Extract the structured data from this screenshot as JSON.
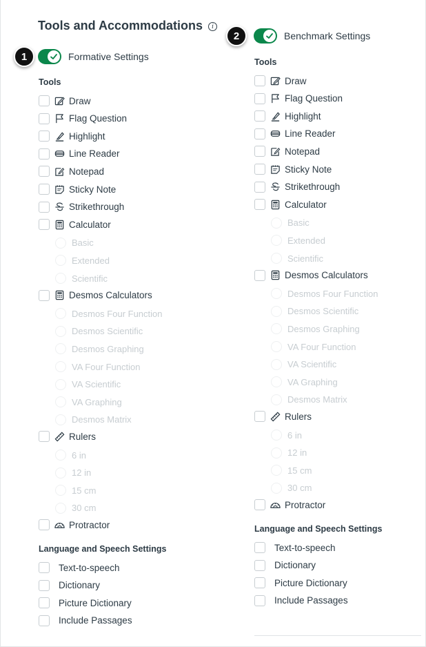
{
  "page_title": "Tools and Accommodations",
  "info_icon": "i",
  "formative": {
    "badge": "1",
    "toggle_label": "Formative Settings",
    "tools_heading": "Tools",
    "tools": [
      {
        "label": "Draw",
        "icon": "draw-icon"
      },
      {
        "label": "Flag Question",
        "icon": "flag-icon"
      },
      {
        "label": "Highlight",
        "icon": "highlight-icon"
      },
      {
        "label": "Line Reader",
        "icon": "line-reader-icon"
      },
      {
        "label": "Notepad",
        "icon": "notepad-icon"
      },
      {
        "label": "Sticky Note",
        "icon": "sticky-note-icon"
      },
      {
        "label": "Strikethrough",
        "icon": "strikethrough-icon"
      },
      {
        "label": "Calculator",
        "icon": "calculator-icon"
      }
    ],
    "calculator_options": [
      "Basic",
      "Extended",
      "Scientific"
    ],
    "desmos": {
      "label": "Desmos Calculators",
      "icon": "calculator-icon"
    },
    "desmos_options": [
      "Desmos Four Function",
      "Desmos Scientific",
      "Desmos Graphing",
      "VA Four Function",
      "VA Scientific",
      "VA Graphing",
      "Desmos Matrix"
    ],
    "rulers": {
      "label": "Rulers",
      "icon": "ruler-icon"
    },
    "ruler_options": [
      "6 in",
      "12 in",
      "15 cm",
      "30 cm"
    ],
    "protractor": {
      "label": "Protractor",
      "icon": "protractor-icon"
    },
    "language_heading": "Language and Speech Settings",
    "language_items": [
      "Text-to-speech",
      "Dictionary",
      "Picture Dictionary",
      "Include Passages"
    ]
  },
  "benchmark": {
    "badge": "2",
    "toggle_label": "Benchmark Settings",
    "tools_heading": "Tools",
    "tools": [
      {
        "label": "Draw",
        "icon": "draw-icon"
      },
      {
        "label": "Flag Question",
        "icon": "flag-icon"
      },
      {
        "label": "Highlight",
        "icon": "highlight-icon"
      },
      {
        "label": "Line Reader",
        "icon": "line-reader-icon"
      },
      {
        "label": "Notepad",
        "icon": "notepad-icon"
      },
      {
        "label": "Sticky Note",
        "icon": "sticky-note-icon"
      },
      {
        "label": "Strikethrough",
        "icon": "strikethrough-icon"
      },
      {
        "label": "Calculator",
        "icon": "calculator-icon"
      }
    ],
    "calculator_options": [
      "Basic",
      "Extended",
      "Scientific"
    ],
    "desmos": {
      "label": "Desmos Calculators",
      "icon": "calculator-icon"
    },
    "desmos_options": [
      "Desmos Four Function",
      "Desmos Scientific",
      "Desmos Graphing",
      "VA Four Function",
      "VA Scientific",
      "VA Graphing",
      "Desmos Matrix"
    ],
    "rulers": {
      "label": "Rulers",
      "icon": "ruler-icon"
    },
    "ruler_options": [
      "6 in",
      "12 in",
      "15 cm",
      "30 cm"
    ],
    "protractor": {
      "label": "Protractor",
      "icon": "protractor-icon"
    },
    "language_heading": "Language and Speech Settings",
    "language_items": [
      "Text-to-speech",
      "Dictionary",
      "Picture Dictionary",
      "Include Passages"
    ]
  },
  "colors": {
    "toggle_on": "#0b874b",
    "text": "#2d3b45",
    "disabled_text": "#c7cdd1",
    "badge": "#111111"
  }
}
